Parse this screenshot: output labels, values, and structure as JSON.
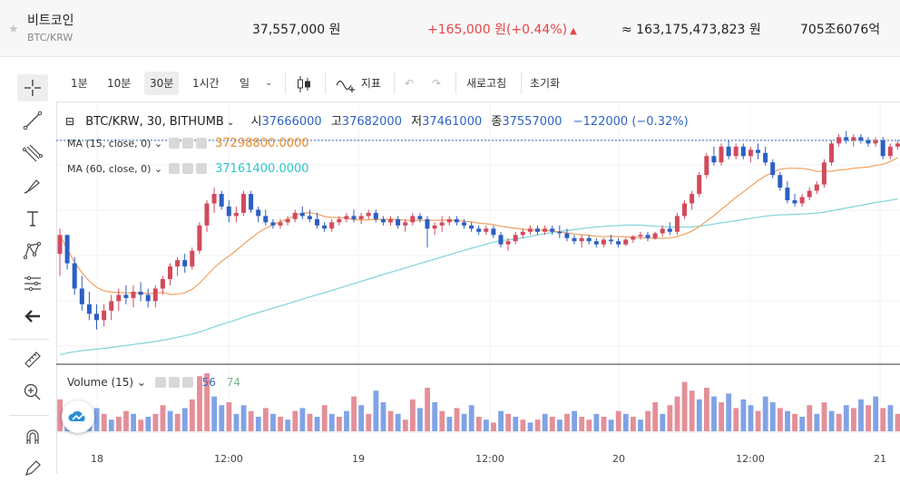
{
  "header": {
    "coin_name": "비트코인",
    "pair": "BTC/KRW",
    "price": "37,557,000 원",
    "change": "+165,000 원(+0.44%)",
    "change_arrow": "▲",
    "volume_krw": "≈ 163,175,473,823 원",
    "market_cap": "705조6076억",
    "up_color": "#e44545"
  },
  "toolbar": {
    "intervals": [
      "1분",
      "10분",
      "30분",
      "1시간",
      "일"
    ],
    "active_interval": "30분",
    "indicator_label": "지표",
    "refresh_label": "새로고침",
    "reset_label": "초기화"
  },
  "legend": {
    "symbol": "BTC/KRW, 30, BITHUMB",
    "open_label": "시",
    "open": "37666000",
    "high_label": "고",
    "high": "37682000",
    "low_label": "저",
    "low": "37461000",
    "close_label": "종",
    "close": "37557000",
    "change": "−122000 (−0.32%)",
    "ma15_label": "MA (15, close, 0)",
    "ma15_value": "37298800.0000",
    "ma60_label": "MA (60, close, 0)",
    "ma60_value": "37161400.0000",
    "volume_label": "Volume (15)",
    "vol_value_1": "56",
    "vol_value_2": "74"
  },
  "chart_data": {
    "type": "candlestick",
    "x_tick_labels": [
      "18",
      "12:00",
      "19",
      "12:00",
      "20",
      "12:00",
      "21"
    ],
    "colors": {
      "up": "#d24a5c",
      "down": "#2c5fc4",
      "ma15": "#f0a060",
      "ma60": "#7fd4da",
      "vol_up": "#e48f98",
      "vol_down": "#7fa3e6"
    },
    "candles": [
      [
        37300,
        37380,
        37230,
        37360
      ],
      [
        37360,
        37360,
        37250,
        37270
      ],
      [
        37270,
        37290,
        37170,
        37190
      ],
      [
        37190,
        37230,
        37120,
        37140
      ],
      [
        37140,
        37180,
        37090,
        37110
      ],
      [
        37110,
        37140,
        37060,
        37090
      ],
      [
        37090,
        37140,
        37070,
        37120
      ],
      [
        37120,
        37170,
        37090,
        37150
      ],
      [
        37150,
        37190,
        37120,
        37170
      ],
      [
        37170,
        37200,
        37140,
        37160
      ],
      [
        37160,
        37200,
        37130,
        37180
      ],
      [
        37180,
        37210,
        37150,
        37170
      ],
      [
        37170,
        37190,
        37130,
        37150
      ],
      [
        37150,
        37200,
        37130,
        37190
      ],
      [
        37190,
        37230,
        37170,
        37220
      ],
      [
        37220,
        37270,
        37200,
        37260
      ],
      [
        37260,
        37290,
        37230,
        37280
      ],
      [
        37280,
        37300,
        37240,
        37260
      ],
      [
        37260,
        37320,
        37250,
        37310
      ],
      [
        37310,
        37400,
        37300,
        37390
      ],
      [
        37390,
        37470,
        37370,
        37460
      ],
      [
        37460,
        37510,
        37430,
        37490
      ],
      [
        37490,
        37500,
        37440,
        37450
      ],
      [
        37450,
        37470,
        37400,
        37420
      ],
      [
        37420,
        37450,
        37400,
        37430
      ],
      [
        37430,
        37500,
        37420,
        37490
      ],
      [
        37490,
        37500,
        37430,
        37440
      ],
      [
        37440,
        37450,
        37400,
        37420
      ],
      [
        37420,
        37440,
        37390,
        37400
      ],
      [
        37400,
        37410,
        37380,
        37390
      ],
      [
        37390,
        37410,
        37380,
        37400
      ],
      [
        37400,
        37420,
        37390,
        37410
      ],
      [
        37410,
        37440,
        37400,
        37430
      ],
      [
        37430,
        37450,
        37410,
        37420
      ],
      [
        37420,
        37440,
        37400,
        37410
      ],
      [
        37410,
        37430,
        37380,
        37390
      ],
      [
        37390,
        37400,
        37370,
        37380
      ],
      [
        37380,
        37410,
        37370,
        37400
      ],
      [
        37400,
        37420,
        37390,
        37410
      ],
      [
        37410,
        37430,
        37400,
        37420
      ],
      [
        37420,
        37440,
        37400,
        37410
      ],
      [
        37410,
        37430,
        37395,
        37420
      ],
      [
        37420,
        37440,
        37410,
        37430
      ],
      [
        37430,
        37440,
        37400,
        37410
      ],
      [
        37410,
        37420,
        37390,
        37400
      ],
      [
        37400,
        37420,
        37390,
        37410
      ],
      [
        37410,
        37420,
        37380,
        37390
      ],
      [
        37390,
        37410,
        37370,
        37400
      ],
      [
        37400,
        37430,
        37390,
        37420
      ],
      [
        37420,
        37430,
        37400,
        37410
      ],
      [
        37410,
        37420,
        37320,
        37380
      ],
      [
        37380,
        37400,
        37360,
        37390
      ],
      [
        37390,
        37420,
        37370,
        37400
      ],
      [
        37400,
        37420,
        37390,
        37410
      ],
      [
        37410,
        37420,
        37390,
        37400
      ],
      [
        37400,
        37410,
        37380,
        37390
      ],
      [
        37390,
        37400,
        37370,
        37380
      ],
      [
        37380,
        37390,
        37360,
        37370
      ],
      [
        37370,
        37390,
        37360,
        37380
      ],
      [
        37380,
        37390,
        37350,
        37360
      ],
      [
        37360,
        37370,
        37320,
        37330
      ],
      [
        37330,
        37350,
        37310,
        37340
      ],
      [
        37340,
        37370,
        37330,
        37360
      ],
      [
        37360,
        37380,
        37350,
        37370
      ],
      [
        37370,
        37390,
        37360,
        37380
      ],
      [
        37380,
        37390,
        37360,
        37370
      ],
      [
        37370,
        37390,
        37360,
        37380
      ],
      [
        37380,
        37390,
        37360,
        37370
      ],
      [
        37370,
        37390,
        37350,
        37365
      ],
      [
        37365,
        37380,
        37340,
        37350
      ],
      [
        37350,
        37360,
        37330,
        37340
      ],
      [
        37340,
        37360,
        37320,
        37350
      ],
      [
        37350,
        37360,
        37330,
        37340
      ],
      [
        37340,
        37350,
        37320,
        37330
      ],
      [
        37330,
        37350,
        37320,
        37345
      ],
      [
        37345,
        37360,
        37330,
        37340
      ],
      [
        37340,
        37350,
        37320,
        37330
      ],
      [
        37330,
        37350,
        37325,
        37345
      ],
      [
        37345,
        37360,
        37335,
        37355
      ],
      [
        37355,
        37370,
        37345,
        37360
      ],
      [
        37360,
        37370,
        37340,
        37350
      ],
      [
        37350,
        37370,
        37345,
        37365
      ],
      [
        37365,
        37390,
        37355,
        37380
      ],
      [
        37380,
        37400,
        37360,
        37370
      ],
      [
        37370,
        37430,
        37360,
        37420
      ],
      [
        37420,
        37470,
        37410,
        37460
      ],
      [
        37460,
        37500,
        37440,
        37490
      ],
      [
        37490,
        37560,
        37480,
        37550
      ],
      [
        37550,
        37620,
        37540,
        37610
      ],
      [
        37610,
        37640,
        37580,
        37590
      ],
      [
        37590,
        37650,
        37580,
        37640
      ],
      [
        37640,
        37660,
        37600,
        37610
      ],
      [
        37610,
        37650,
        37600,
        37640
      ],
      [
        37640,
        37650,
        37600,
        37610
      ],
      [
        37610,
        37640,
        37590,
        37630
      ],
      [
        37630,
        37650,
        37600,
        37620
      ],
      [
        37620,
        37640,
        37580,
        37590
      ],
      [
        37590,
        37600,
        37540,
        37550
      ],
      [
        37550,
        37560,
        37500,
        37510
      ],
      [
        37510,
        37530,
        37460,
        37470
      ],
      [
        37470,
        37490,
        37450,
        37460
      ],
      [
        37460,
        37490,
        37450,
        37480
      ],
      [
        37480,
        37510,
        37470,
        37500
      ],
      [
        37500,
        37530,
        37490,
        37520
      ],
      [
        37520,
        37600,
        37510,
        37590
      ],
      [
        37590,
        37660,
        37580,
        37650
      ],
      [
        37650,
        37680,
        37640,
        37670
      ],
      [
        37670,
        37690,
        37650,
        37660
      ],
      [
        37660,
        37680,
        37640,
        37670
      ],
      [
        37670,
        37680,
        37650,
        37660
      ],
      [
        37660,
        37670,
        37640,
        37650
      ],
      [
        37650,
        37670,
        37640,
        37660
      ],
      [
        37660,
        37670,
        37600,
        37610
      ],
      [
        37610,
        37650,
        37600,
        37640
      ],
      [
        37640,
        37660,
        37630,
        37650
      ]
    ],
    "volumes": [
      [
        1,
        0.55
      ],
      [
        0,
        0.35
      ],
      [
        0,
        0.3
      ],
      [
        1,
        0.45
      ],
      [
        0,
        0.25
      ],
      [
        0,
        0.4
      ],
      [
        1,
        0.3
      ],
      [
        0,
        0.2
      ],
      [
        1,
        0.25
      ],
      [
        1,
        0.35
      ],
      [
        0,
        0.3
      ],
      [
        1,
        0.2
      ],
      [
        0,
        0.25
      ],
      [
        1,
        0.3
      ],
      [
        1,
        0.45
      ],
      [
        0,
        0.35
      ],
      [
        1,
        0.3
      ],
      [
        0,
        0.4
      ],
      [
        1,
        0.55
      ],
      [
        1,
        0.95
      ],
      [
        1,
        1.0
      ],
      [
        0,
        0.6
      ],
      [
        0,
        0.45
      ],
      [
        1,
        0.5
      ],
      [
        0,
        0.3
      ],
      [
        0,
        0.45
      ],
      [
        1,
        0.35
      ],
      [
        0,
        0.25
      ],
      [
        1,
        0.4
      ],
      [
        0,
        0.3
      ],
      [
        1,
        0.25
      ],
      [
        0,
        0.2
      ],
      [
        1,
        0.35
      ],
      [
        0,
        0.4
      ],
      [
        1,
        0.3
      ],
      [
        0,
        0.25
      ],
      [
        1,
        0.45
      ],
      [
        0,
        0.3
      ],
      [
        1,
        0.25
      ],
      [
        0,
        0.35
      ],
      [
        1,
        0.6
      ],
      [
        0,
        0.45
      ],
      [
        1,
        0.3
      ],
      [
        0,
        0.7
      ],
      [
        0,
        0.5
      ],
      [
        1,
        0.35
      ],
      [
        0,
        0.3
      ],
      [
        1,
        0.2
      ],
      [
        1,
        0.55
      ],
      [
        0,
        0.4
      ],
      [
        1,
        0.75
      ],
      [
        0,
        0.5
      ],
      [
        1,
        0.35
      ],
      [
        0,
        0.25
      ],
      [
        1,
        0.4
      ],
      [
        0,
        0.3
      ],
      [
        0,
        0.45
      ],
      [
        1,
        0.25
      ],
      [
        0,
        0.2
      ],
      [
        1,
        0.15
      ],
      [
        0,
        0.35
      ],
      [
        1,
        0.3
      ],
      [
        0,
        0.25
      ],
      [
        1,
        0.2
      ],
      [
        0,
        0.15
      ],
      [
        1,
        0.2
      ],
      [
        0,
        0.3
      ],
      [
        1,
        0.25
      ],
      [
        0,
        0.2
      ],
      [
        1,
        0.3
      ],
      [
        0,
        0.35
      ],
      [
        1,
        0.25
      ],
      [
        1,
        0.2
      ],
      [
        0,
        0.3
      ],
      [
        1,
        0.25
      ],
      [
        0,
        0.2
      ],
      [
        1,
        0.35
      ],
      [
        0,
        0.3
      ],
      [
        1,
        0.25
      ],
      [
        0,
        0.2
      ],
      [
        1,
        0.35
      ],
      [
        1,
        0.5
      ],
      [
        0,
        0.3
      ],
      [
        1,
        0.45
      ],
      [
        1,
        0.6
      ],
      [
        1,
        0.85
      ],
      [
        1,
        0.7
      ],
      [
        0,
        0.55
      ],
      [
        1,
        0.75
      ],
      [
        0,
        0.6
      ],
      [
        1,
        0.5
      ],
      [
        0,
        0.65
      ],
      [
        1,
        0.4
      ],
      [
        0,
        0.55
      ],
      [
        0,
        0.45
      ],
      [
        1,
        0.35
      ],
      [
        0,
        0.6
      ],
      [
        0,
        0.5
      ],
      [
        1,
        0.4
      ],
      [
        0,
        0.35
      ],
      [
        1,
        0.3
      ],
      [
        0,
        0.25
      ],
      [
        1,
        0.45
      ],
      [
        0,
        0.3
      ],
      [
        1,
        0.5
      ],
      [
        0,
        0.35
      ],
      [
        1,
        0.3
      ],
      [
        0,
        0.45
      ],
      [
        1,
        0.4
      ],
      [
        0,
        0.55
      ],
      [
        1,
        0.45
      ],
      [
        0,
        0.6
      ],
      [
        1,
        0.4
      ],
      [
        0,
        0.45
      ],
      [
        1,
        0.3
      ]
    ]
  }
}
